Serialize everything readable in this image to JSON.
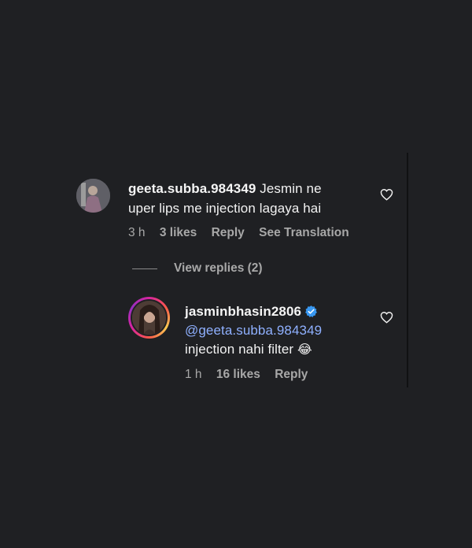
{
  "comment1": {
    "username": "geeta.subba.984349",
    "text_line1": "Jesmin ne",
    "text_line2": "uper lips me injection lagaya hai",
    "time": "3 h",
    "likes": "3 likes",
    "reply": "Reply",
    "translate": "See Translation",
    "avatar_icon": "profile-photo"
  },
  "view_replies": "View replies (2)",
  "reply1": {
    "username": "jasminbhasin2806",
    "mention": "@geeta.subba.984349",
    "text": "injection nahi filter",
    "emoji": "😂",
    "time": "1 h",
    "likes": "16 likes",
    "reply": "Reply",
    "verified_icon": "verified-badge",
    "avatar_icon": "profile-photo-story-ring"
  },
  "colors": {
    "background": "#1f2023",
    "text": "#f5f5f5",
    "meta": "#a8a8a8",
    "mention": "#8fb0ff",
    "verified": "#3897f0"
  }
}
